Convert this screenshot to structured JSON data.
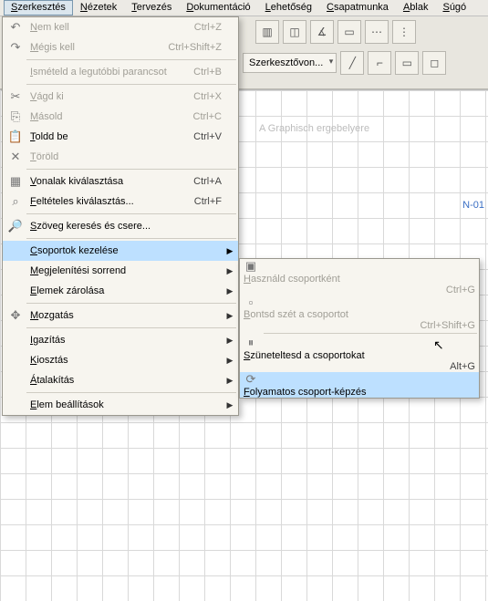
{
  "menubar": {
    "items": [
      {
        "pre": "",
        "u": "S",
        "post": "zerkesztés"
      },
      {
        "pre": "",
        "u": "N",
        "post": "ézetek"
      },
      {
        "pre": "",
        "u": "T",
        "post": "ervezés"
      },
      {
        "pre": "",
        "u": "D",
        "post": "okumentáció"
      },
      {
        "pre": "",
        "u": "L",
        "post": "ehetőség"
      },
      {
        "pre": "",
        "u": "C",
        "post": "sapatmunka"
      },
      {
        "pre": "",
        "u": "A",
        "post": "blak"
      },
      {
        "pre": "",
        "u": "S",
        "post": "úgó"
      }
    ]
  },
  "toolbar": {
    "editor_chip": "Szerkesztővon..."
  },
  "canvas": {
    "ghost_text": "A Graphisch ergebelyere",
    "n_label": "N-01"
  },
  "menu": {
    "undo": {
      "pre": "",
      "u": "N",
      "post": "em kell",
      "shortcut": "Ctrl+Z",
      "disabled": true
    },
    "redo": {
      "pre": "",
      "u": "M",
      "post": "égis kell",
      "shortcut": "Ctrl+Shift+Z",
      "disabled": true
    },
    "repeat": {
      "pre": "",
      "u": "I",
      "post": "smételd a legutóbbi parancsot",
      "shortcut": "Ctrl+B",
      "disabled": true
    },
    "cut": {
      "pre": "",
      "u": "V",
      "post": "ágd ki",
      "shortcut": "Ctrl+X",
      "disabled": true
    },
    "copy": {
      "pre": "",
      "u": "M",
      "post": "ásold",
      "shortcut": "Ctrl+C",
      "disabled": true
    },
    "paste": {
      "pre": "",
      "u": "T",
      "post": "oldd be",
      "shortcut": "Ctrl+V",
      "disabled": false
    },
    "delete": {
      "pre": "",
      "u": "T",
      "post": "öröld",
      "shortcut": "",
      "disabled": true
    },
    "sel_lines": {
      "pre": "",
      "u": "V",
      "post": "onalak kiválasztása",
      "shortcut": "Ctrl+A",
      "disabled": false
    },
    "sel_cond": {
      "pre": "",
      "u": "F",
      "post": "eltételes kiválasztás...",
      "shortcut": "Ctrl+F",
      "disabled": false
    },
    "find": {
      "pre": "",
      "u": "S",
      "post": "zöveg keresés és csere...",
      "shortcut": "",
      "disabled": false
    },
    "groups": {
      "pre": "",
      "u": "C",
      "post": "soportok kezelése",
      "shortcut": "",
      "disabled": false
    },
    "display": {
      "pre": "",
      "u": "M",
      "post": "egjelenítési sorrend",
      "shortcut": "",
      "disabled": false
    },
    "lock": {
      "pre": "",
      "u": "E",
      "post": "lemek zárolása",
      "shortcut": "",
      "disabled": false
    },
    "move": {
      "pre": "",
      "u": "M",
      "post": "ozgatás",
      "shortcut": "",
      "disabled": false
    },
    "align": {
      "pre": "",
      "u": "I",
      "post": "gazítás",
      "shortcut": "",
      "disabled": false
    },
    "distrib": {
      "pre": "",
      "u": "K",
      "post": "iosztás",
      "shortcut": "",
      "disabled": false
    },
    "reshape": {
      "pre": "",
      "u": "Á",
      "post": "talakítás",
      "shortcut": "",
      "disabled": false
    },
    "settings": {
      "pre": "",
      "u": "E",
      "post": "lem beállítások",
      "shortcut": "",
      "disabled": false
    }
  },
  "submenu": {
    "use": {
      "pre": "",
      "u": "H",
      "post": "asználd csoportként",
      "shortcut": "Ctrl+G",
      "disabled": true
    },
    "break": {
      "pre": "",
      "u": "B",
      "post": "ontsd szét a csoportot",
      "shortcut": "Ctrl+Shift+G",
      "disabled": true
    },
    "suspend": {
      "pre": "",
      "u": "S",
      "post": "züneteltesd a csoportokat",
      "shortcut": "Alt+G",
      "disabled": false
    },
    "cont": {
      "pre": "",
      "u": "F",
      "post": "olyamatos csoport-képzés",
      "shortcut": "",
      "disabled": false
    }
  }
}
